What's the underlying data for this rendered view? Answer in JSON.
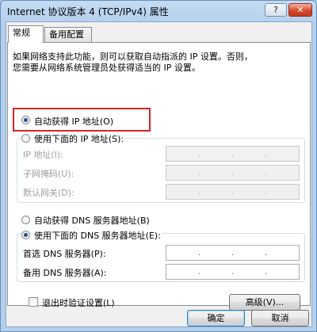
{
  "window": {
    "title": "Internet 协议版本 4 (TCP/IPv4) 属性",
    "help_label": "?",
    "close_label": "✕"
  },
  "tabs": [
    {
      "label": "常规",
      "active": true
    },
    {
      "label": "备用配置",
      "active": false
    }
  ],
  "description": {
    "line1": "如果网络支持此功能，则可以获取自动指派的 IP 设置。否则，",
    "line2": "您需要从网络系统管理员处获得适当的 IP 设置。"
  },
  "ip_section": {
    "auto_label": "自动获得 IP 地址(O)",
    "auto_checked": true,
    "manual_label": "使用下面的 IP 地址(S):",
    "manual_checked": false,
    "fields": [
      {
        "label": "IP 地址(I):",
        "value": ""
      },
      {
        "label": "子网掩码(U):",
        "value": ""
      },
      {
        "label": "默认网关(D):",
        "value": ""
      }
    ]
  },
  "dns_section": {
    "auto_label": "自动获得 DNS 服务器地址(B)",
    "auto_checked": false,
    "manual_label": "使用下面的 DNS 服务器地址(E):",
    "manual_checked": true,
    "fields": [
      {
        "label": "首选 DNS 服务器(P):",
        "value": ""
      },
      {
        "label": "备用 DNS 服务器(A):",
        "value": ""
      }
    ]
  },
  "validate_on_exit": {
    "label": "退出时验证设置(L)",
    "checked": false
  },
  "buttons": {
    "advanced": "高级(V)...",
    "ok": "确定",
    "cancel": "取消"
  },
  "colors": {
    "highlight_border": "#d8232a",
    "radio_dot": "#1f4e9a"
  }
}
